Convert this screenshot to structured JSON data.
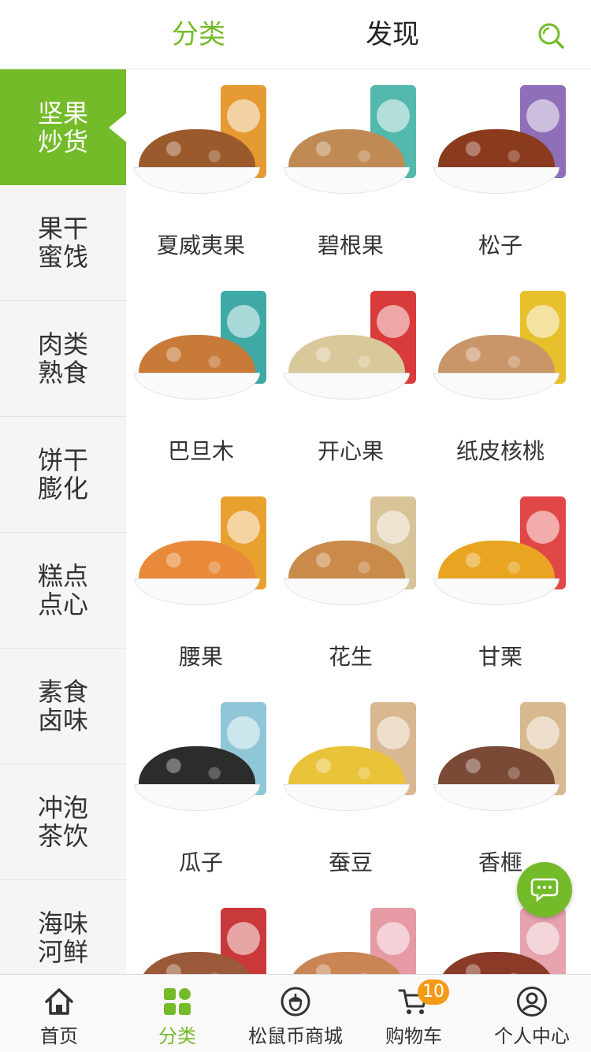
{
  "header": {
    "tab_category": "分类",
    "tab_discover": "发现",
    "search_icon": "search-icon"
  },
  "sidebar": {
    "items": [
      {
        "label": "坚果炒货",
        "active": true
      },
      {
        "label": "果干蜜饯"
      },
      {
        "label": "肉类熟食"
      },
      {
        "label": "饼干膨化"
      },
      {
        "label": "糕点点心"
      },
      {
        "label": "素食卤味"
      },
      {
        "label": "冲泡茶饮"
      },
      {
        "label": "海味河鲜"
      }
    ]
  },
  "products": [
    {
      "name": "夏威夷果",
      "pkg": "#e69a34",
      "nut": "#9b5a2c"
    },
    {
      "name": "碧根果",
      "pkg": "#54b9ad",
      "nut": "#c08a55"
    },
    {
      "name": "松子",
      "pkg": "#8e6fb8",
      "nut": "#8a3b1d"
    },
    {
      "name": "巴旦木",
      "pkg": "#3fa9a6",
      "nut": "#c87a38"
    },
    {
      "name": "开心果",
      "pkg": "#d93a3a",
      "nut": "#d9c89a"
    },
    {
      "name": "纸皮核桃",
      "pkg": "#e6c12d",
      "nut": "#c9966a"
    },
    {
      "name": "腰果",
      "pkg": "#e8a02f",
      "nut": "#e88a3a"
    },
    {
      "name": "花生",
      "pkg": "#d9c49a",
      "nut": "#c98a4a"
    },
    {
      "name": "甘栗",
      "pkg": "#e24747",
      "nut": "#e9a521"
    },
    {
      "name": "瓜子",
      "pkg": "#8fc7d8",
      "nut": "#2c2c2c"
    },
    {
      "name": "蚕豆",
      "pkg": "#d9b891",
      "nut": "#e9c43a"
    },
    {
      "name": "香榧",
      "pkg": "#d8b88e",
      "nut": "#7a4a36"
    },
    {
      "name": "",
      "pkg": "#c9393b",
      "nut": "#9a5a3a"
    },
    {
      "name": "",
      "pkg": "#e59aa4",
      "nut": "#c98654"
    },
    {
      "name": "",
      "pkg": "#e6a2ad",
      "nut": "#8a3a26"
    }
  ],
  "chat_icon": "chat-bubble-icon",
  "bottom_nav": {
    "items": [
      {
        "label": "首页",
        "icon": "home-icon"
      },
      {
        "label": "分类",
        "icon": "category-grid-icon",
        "active": true
      },
      {
        "label": "松鼠币商城",
        "icon": "acorn-coin-icon"
      },
      {
        "label": "购物车",
        "icon": "cart-icon",
        "badge": "10"
      },
      {
        "label": "个人中心",
        "icon": "profile-icon"
      }
    ]
  },
  "colors": {
    "accent": "#74bb2a",
    "badge": "#f39a17"
  }
}
